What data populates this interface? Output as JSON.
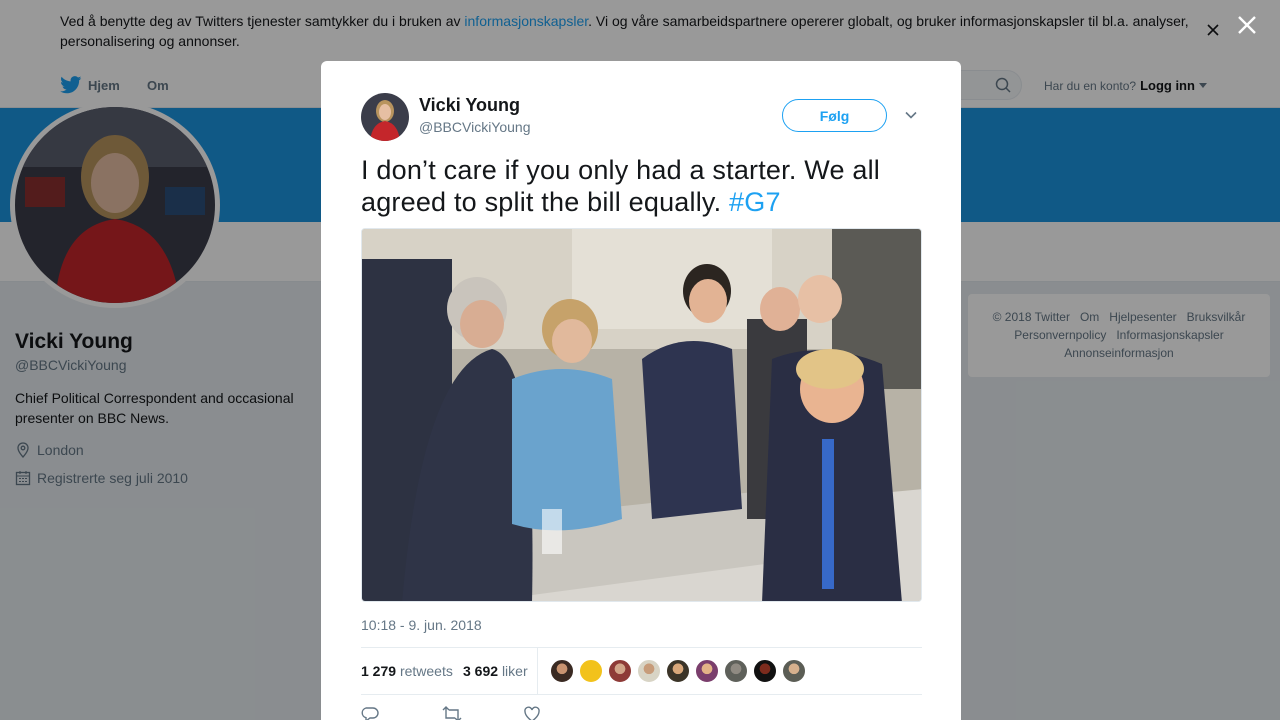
{
  "cookie_banner": {
    "text_before": "Ved å benytte deg av Twitters tjenester samtykker du i bruken av ",
    "link": "informasjonskapsler",
    "text_after": ". Vi og våre samarbeidspartnere opererer globalt, og bruker informasjonskapsler til bl.a. analyser, personalisering og annonser."
  },
  "nav": {
    "home": "Hjem",
    "about": "Om",
    "login_prompt": "Har du en konto?",
    "login": "Logg inn"
  },
  "profile": {
    "name": "Vicki Young",
    "handle": "@BBCVickiYoung",
    "bio": "Chief Political Correspondent and occasional presenter on BBC News.",
    "location": "London",
    "joined": "Registrerte seg juli 2010"
  },
  "footer": {
    "links": [
      "© 2018 Twitter",
      "Om",
      "Hjelpesenter",
      "Bruksvilkår",
      "Personvernpolicy",
      "Informasjonskapsler",
      "Annonseinformasjon"
    ]
  },
  "tweet": {
    "author_name": "Vicki Young",
    "author_handle": "@BBCVickiYoung",
    "follow_label": "Følg",
    "text": "I don’t care if you only had a starter. We all agreed to split the bill equally. ",
    "hashtag": "#G7",
    "timestamp": "10:18 - 9. jun. 2018",
    "retweets_count": "1 279",
    "retweets_label": "retweets",
    "likes_count": "3 692",
    "likes_label": "liker",
    "liker_count": 9
  },
  "colors": {
    "accent": "#1da1f2",
    "banner": "#1b95e0",
    "overlay": "rgba(0,0,0,0.4)"
  }
}
